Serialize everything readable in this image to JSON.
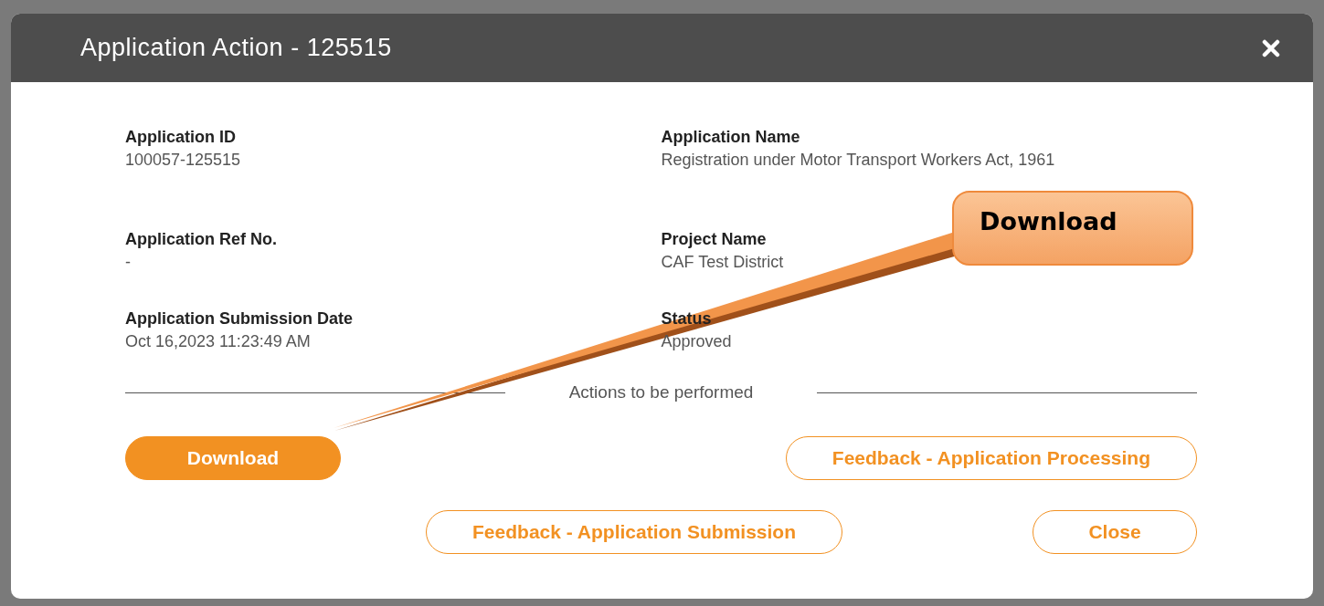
{
  "modal": {
    "title": "Application Action - 125515"
  },
  "fields": [
    {
      "label": "Application ID",
      "value": "100057-125515"
    },
    {
      "label": "Application Name",
      "value": "Registration under Motor Transport Workers Act, 1961"
    },
    {
      "label": "Application Ref No.",
      "value": "-"
    },
    {
      "label": "Project Name",
      "value": "CAF Test District"
    },
    {
      "label": "Application Submission Date",
      "value": "Oct 16,2023 11:23:49 AM"
    },
    {
      "label": "Status",
      "value": "Approved"
    }
  ],
  "actions_heading": "Actions to be performed",
  "button_rows": [
    [
      {
        "label": "Download",
        "kind": "filled"
      },
      {
        "label": "Feedback - Application Processing",
        "kind": "outline"
      }
    ],
    [
      {
        "label": "Feedback - Application Submission",
        "kind": "outline"
      },
      {
        "label": "Close",
        "kind": "outline"
      }
    ]
  ],
  "callout": {
    "text": "Download"
  }
}
